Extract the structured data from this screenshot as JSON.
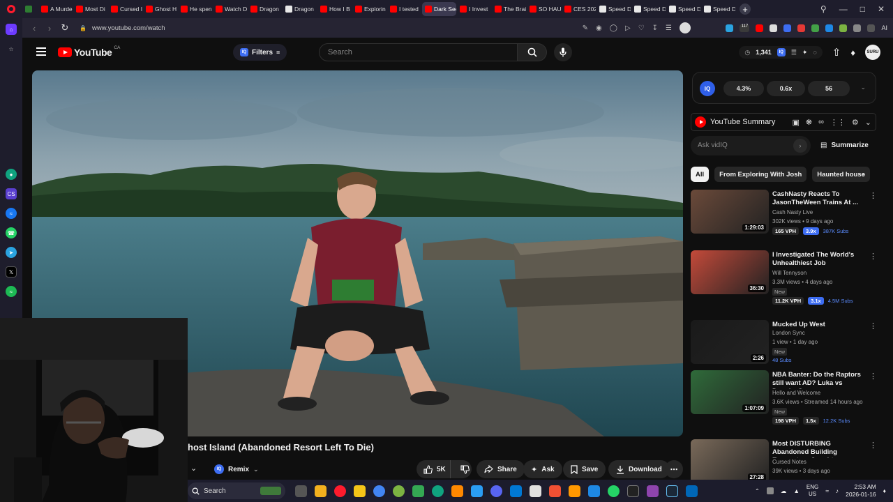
{
  "browser": {
    "tabs": [
      {
        "label": "",
        "fav": "green"
      },
      {
        "label": "A Murde",
        "fav": "yt"
      },
      {
        "label": "Most Di",
        "fav": "yt"
      },
      {
        "label": "Cursed I",
        "fav": "yt"
      },
      {
        "label": "Ghost H",
        "fav": "yt"
      },
      {
        "label": "He spen",
        "fav": "yt"
      },
      {
        "label": "Watch D",
        "fav": "yt"
      },
      {
        "label": "Dragon",
        "fav": "yt"
      },
      {
        "label": "Dragon",
        "fav": "wiki"
      },
      {
        "label": "How I B",
        "fav": "yt"
      },
      {
        "label": "Explorin",
        "fav": "yt"
      },
      {
        "label": "I tested",
        "fav": "yt"
      },
      {
        "label": "Dark Secre",
        "fav": "yt",
        "active": true
      },
      {
        "label": "I Invest",
        "fav": "yt"
      },
      {
        "label": "The Brai",
        "fav": "yt"
      },
      {
        "label": "SO HAU",
        "fav": "yt"
      },
      {
        "label": "CES 202",
        "fav": "yt"
      },
      {
        "label": "Speed D",
        "fav": "wiki"
      },
      {
        "label": "Speed D",
        "fav": "wiki"
      },
      {
        "label": "Speed D",
        "fav": "wiki"
      },
      {
        "label": "Speed D",
        "fav": "wiki"
      }
    ],
    "new_tab": "+",
    "url": "www.youtube.com/watch",
    "ext_badge": "117",
    "ai_label": "AI"
  },
  "youtube": {
    "logo_text": "YouTube",
    "country": "CA",
    "filters_label": "Filters",
    "iq_short": "IQ",
    "search_placeholder": "Search",
    "watch_count": "1,341",
    "avatar_text": "SURU"
  },
  "video": {
    "title": "host Island (Abandoned Resort Left To Die)",
    "remix_label": "Remix",
    "like_count": "5K",
    "share_label": "Share",
    "ask_label": "Ask",
    "save_label": "Save",
    "download_label": "Download"
  },
  "vidiq": {
    "logo": "IQ",
    "stats": [
      "4.3%",
      "0.6x",
      "56"
    ]
  },
  "summary": {
    "title": "YouTube Summary",
    "ask_placeholder": "Ask vidIQ",
    "summarize_label": "Summarize"
  },
  "chips": [
    "All",
    "From Exploring With Josh",
    "Haunted house"
  ],
  "recommendations": [
    {
      "title": "CashNasty Reacts To JasonTheWeen Trains At ...",
      "channel": "Cash Nasty Live",
      "meta": "302K views • 9 days ago",
      "duration": "1:29:03",
      "vph": "165 VPH",
      "mult": "3.9x",
      "subs": "387K Subs",
      "thumb_color": "#6b4a3a"
    },
    {
      "title": "I Investigated The World's Unhealthiest Job",
      "channel": "Will Tennyson",
      "meta": "3.3M views • 4 days ago",
      "new": "New",
      "duration": "36:30",
      "vph": "11.2K VPH",
      "mult": "3.1x",
      "subs": "4.5M Subs",
      "thumb_color": "#c44a3a"
    },
    {
      "title": "Mucked Up West",
      "channel": "London Sync",
      "meta": "1 view • 1 day ago",
      "new": "New",
      "duration": "2:26",
      "subs": "48 Subs",
      "thumb_color": "#1a1a1a"
    },
    {
      "title": "NBA Banter: Do the Raptors still want AD? Luka vs Dennis, Spu...",
      "channel": "Hello and Welcome",
      "meta": "3.6K views • Streamed 14 hours ago",
      "new": "New",
      "duration": "1:07:09",
      "vph": "198 VPH",
      "mult": "1.5x",
      "subs": "12.2K Subs",
      "thumb_color": "#2f6b3a"
    },
    {
      "title": "Most DISTURBING Abandoned Building Encounters Caught o...",
      "channel": "Cursed Notes",
      "meta": "39K views • 3 days ago",
      "duration": "27:28",
      "thumb_color": "#7a6a5a"
    }
  ],
  "taskbar": {
    "search_label": "Search",
    "lang_top": "ENG",
    "lang_bottom": "US",
    "time": "2:53 AM",
    "date": "2026-01-16"
  }
}
